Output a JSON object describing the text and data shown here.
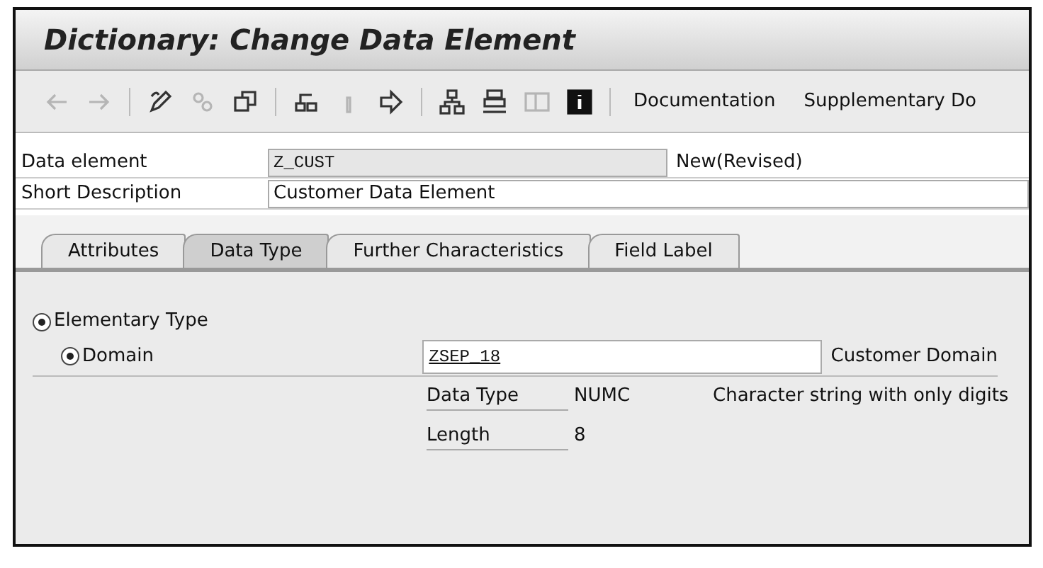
{
  "window": {
    "title": "Dictionary: Change Data Element"
  },
  "toolbar": {
    "buttons": [
      {
        "kind": "back",
        "disabled": true
      },
      {
        "kind": "forward",
        "disabled": true
      },
      {
        "kind": "sep"
      },
      {
        "kind": "edit",
        "disabled": false
      },
      {
        "kind": "link",
        "disabled": true
      },
      {
        "kind": "copy",
        "disabled": false
      },
      {
        "kind": "sep"
      },
      {
        "kind": "object",
        "disabled": false
      },
      {
        "kind": "bar",
        "disabled": true
      },
      {
        "kind": "move",
        "disabled": false
      },
      {
        "kind": "sep"
      },
      {
        "kind": "tree",
        "disabled": false
      },
      {
        "kind": "stack",
        "disabled": false
      },
      {
        "kind": "panel",
        "disabled": true
      },
      {
        "kind": "info",
        "disabled": false
      },
      {
        "kind": "sep"
      }
    ],
    "text_buttons": [
      "Documentation",
      "Supplementary Do"
    ]
  },
  "header": {
    "data_element": {
      "label": "Data element",
      "value": "Z_CUST",
      "status": "New(Revised)"
    },
    "short_description": {
      "label": "Short Description",
      "value": "Customer Data Element"
    }
  },
  "tabs": [
    {
      "label": "Attributes",
      "selected": false
    },
    {
      "label": "Data Type",
      "selected": true
    },
    {
      "label": "Further Characteristics",
      "selected": false
    },
    {
      "label": "Field Label",
      "selected": false
    }
  ],
  "data_type": {
    "elementary": {
      "label": "Elementary Type",
      "selected": true
    },
    "domain": {
      "label": "Domain",
      "selected": true,
      "value": "ZSEP_18",
      "description": "Customer Domain"
    },
    "properties": [
      {
        "label": "Data Type",
        "value": "NUMC",
        "description": "Character string with only digits"
      },
      {
        "label": "Length",
        "value": "8"
      }
    ]
  }
}
